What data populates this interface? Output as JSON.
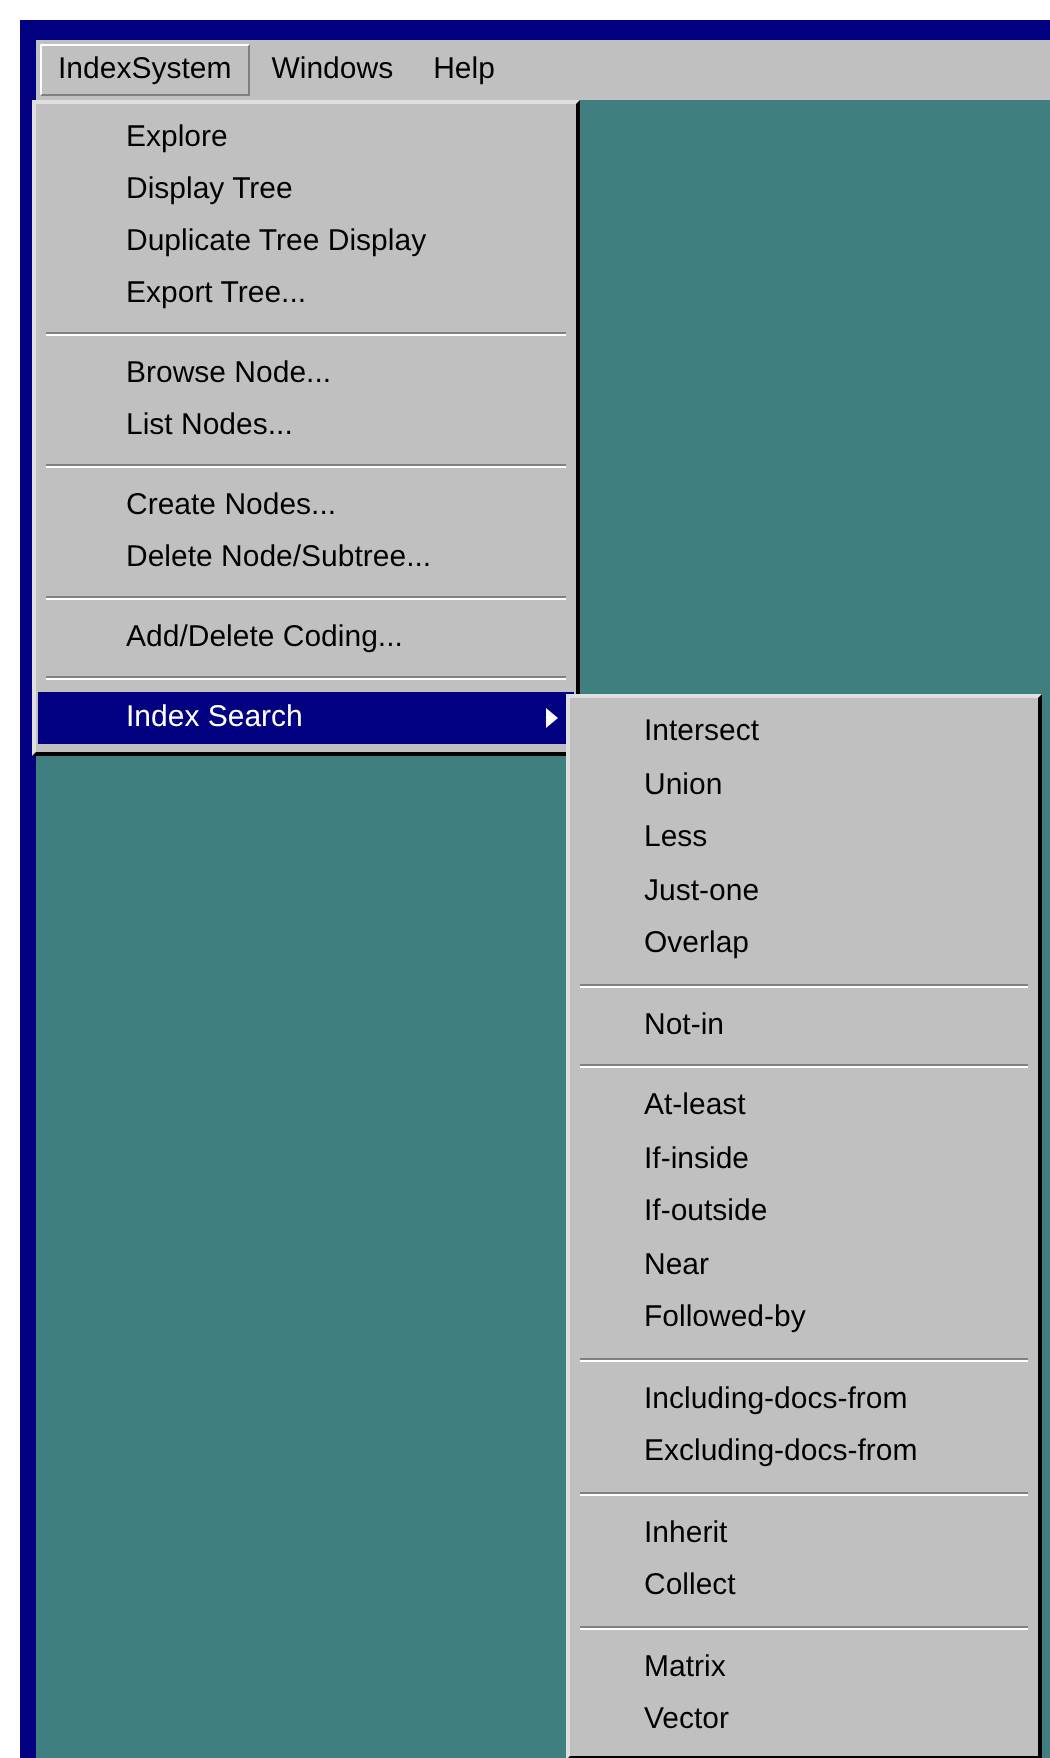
{
  "menubar": [
    {
      "label": "IndexSystem",
      "selected": true
    },
    {
      "label": "Windows",
      "selected": false
    },
    {
      "label": "Help",
      "selected": false
    }
  ],
  "menu": {
    "groups": [
      [
        {
          "label": "Explore",
          "selected": false,
          "submenu": false
        },
        {
          "label": "Display Tree",
          "selected": false,
          "submenu": false
        },
        {
          "label": "Duplicate Tree Display",
          "selected": false,
          "submenu": false
        },
        {
          "label": "Export Tree...",
          "selected": false,
          "submenu": false
        }
      ],
      [
        {
          "label": "Browse Node...",
          "selected": false,
          "submenu": false
        },
        {
          "label": "List Nodes...",
          "selected": false,
          "submenu": false
        }
      ],
      [
        {
          "label": "Create Nodes...",
          "selected": false,
          "submenu": false
        },
        {
          "label": "Delete Node/Subtree...",
          "selected": false,
          "submenu": false
        }
      ],
      [
        {
          "label": "Add/Delete Coding...",
          "selected": false,
          "submenu": false
        }
      ],
      [
        {
          "label": "Index Search",
          "selected": true,
          "submenu": true
        }
      ]
    ]
  },
  "submenu": {
    "groups": [
      [
        {
          "label": "Intersect"
        },
        {
          "label": "Union"
        },
        {
          "label": "Less"
        },
        {
          "label": "Just-one"
        },
        {
          "label": "Overlap"
        }
      ],
      [
        {
          "label": "Not-in"
        }
      ],
      [
        {
          "label": "At-least"
        },
        {
          "label": "If-inside"
        },
        {
          "label": "If-outside"
        },
        {
          "label": "Near"
        },
        {
          "label": "Followed-by"
        }
      ],
      [
        {
          "label": "Including-docs-from"
        },
        {
          "label": "Excluding-docs-from"
        }
      ],
      [
        {
          "label": "Inherit"
        },
        {
          "label": "Collect"
        }
      ],
      [
        {
          "label": "Matrix"
        },
        {
          "label": "Vector"
        }
      ]
    ]
  }
}
